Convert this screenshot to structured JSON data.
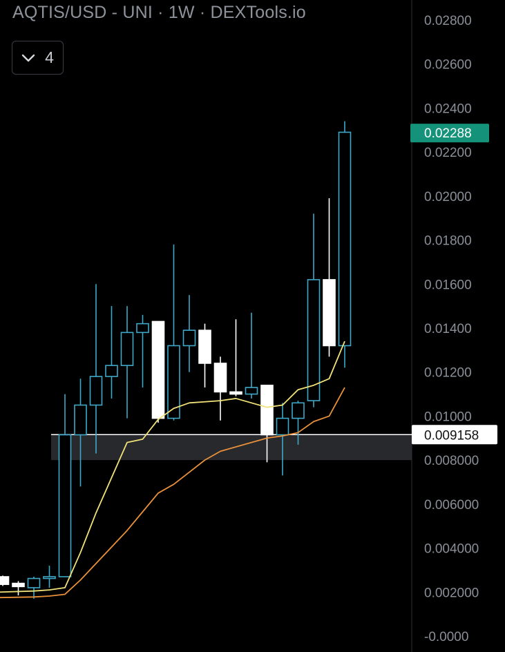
{
  "header": {
    "title": "AQTIS/USD - UNI · 1W · DEXTools.io",
    "indicator_count": "4",
    "collapse_icon": "chevron-down-icon"
  },
  "colors": {
    "background": "#000000",
    "up_candle": "#3fa9c9",
    "down_candle": "#ffffff",
    "ma_fast": "#f2e27a",
    "ma_slow": "#e8913a",
    "last_price_badge": "#14937a",
    "level_line": "#ffffff",
    "zone_fill": "#2b2d31",
    "axis_text": "#8a8f98"
  },
  "chart_data": {
    "type": "candlestick",
    "title": "AQTIS/USD - UNI · 1W · DEXTools.io",
    "y_axis_ticks": [
      "0.02800",
      "0.02600",
      "0.02400",
      "0.02200",
      "0.02000",
      "0.01800",
      "0.01600",
      "0.01400",
      "0.01200",
      "0.01000",
      "0.008000",
      "0.006000",
      "0.004000",
      "0.002000",
      "-0.0000"
    ],
    "ylim": [
      -0.0,
      0.029
    ],
    "grid": false,
    "last_price": "0.02288",
    "level_label": "0.009158",
    "level_value": 0.009158,
    "zone": [
      0.008,
      0.009158
    ],
    "candles": [
      {
        "o": 0.0027,
        "h": 0.00275,
        "l": 0.00228,
        "c": 0.00235
      },
      {
        "o": 0.0024,
        "h": 0.0025,
        "l": 0.00185,
        "c": 0.00225
      },
      {
        "o": 0.0022,
        "h": 0.0027,
        "l": 0.0017,
        "c": 0.00262
      },
      {
        "o": 0.00262,
        "h": 0.0032,
        "l": 0.0022,
        "c": 0.0027
      },
      {
        "o": 0.0027,
        "h": 0.011,
        "l": 0.0027,
        "c": 0.00915
      },
      {
        "o": 0.00915,
        "h": 0.0117,
        "l": 0.0068,
        "c": 0.0105
      },
      {
        "o": 0.0105,
        "h": 0.016,
        "l": 0.0083,
        "c": 0.0118
      },
      {
        "o": 0.0118,
        "h": 0.015,
        "l": 0.0108,
        "c": 0.0123
      },
      {
        "o": 0.0123,
        "h": 0.015,
        "l": 0.0099,
        "c": 0.0138
      },
      {
        "o": 0.0138,
        "h": 0.0146,
        "l": 0.0113,
        "c": 0.0142
      },
      {
        "o": 0.0143,
        "h": 0.0143,
        "l": 0.0097,
        "c": 0.0099
      },
      {
        "o": 0.0099,
        "h": 0.0178,
        "l": 0.0098,
        "c": 0.0132
      },
      {
        "o": 0.0132,
        "h": 0.0155,
        "l": 0.012,
        "c": 0.0139
      },
      {
        "o": 0.0139,
        "h": 0.0142,
        "l": 0.0113,
        "c": 0.0124
      },
      {
        "o": 0.0124,
        "h": 0.0127,
        "l": 0.0098,
        "c": 0.0111
      },
      {
        "o": 0.0111,
        "h": 0.0144,
        "l": 0.0109,
        "c": 0.011
      },
      {
        "o": 0.011,
        "h": 0.0147,
        "l": 0.0108,
        "c": 0.0113
      },
      {
        "o": 0.0114,
        "h": 0.0114,
        "l": 0.0079,
        "c": 0.00915
      },
      {
        "o": 0.00915,
        "h": 0.0106,
        "l": 0.0073,
        "c": 0.0099
      },
      {
        "o": 0.0099,
        "h": 0.0107,
        "l": 0.0087,
        "c": 0.0106
      },
      {
        "o": 0.0107,
        "h": 0.0192,
        "l": 0.0104,
        "c": 0.0162
      },
      {
        "o": 0.0162,
        "h": 0.0199,
        "l": 0.0127,
        "c": 0.0132
      },
      {
        "o": 0.0132,
        "h": 0.0234,
        "l": 0.0122,
        "c": 0.0229
      }
    ],
    "series": [
      {
        "type": "line",
        "values": [
          0.002,
          0.00205,
          0.0021,
          0.0022,
          0.0038,
          0.0056,
          0.0072,
          0.0088,
          0.00895,
          0.00985,
          0.01035,
          0.0106,
          0.01065,
          0.0107,
          0.0108,
          0.0106,
          0.0104,
          0.0105,
          0.0112,
          0.0114,
          0.0117,
          0.0134
        ]
      },
      {
        "type": "line",
        "values": [
          0.00175,
          0.00178,
          0.00182,
          0.0019,
          0.00255,
          0.0033,
          0.00405,
          0.0048,
          0.00565,
          0.0065,
          0.0069,
          0.00745,
          0.008,
          0.0084,
          0.0086,
          0.0088,
          0.009,
          0.0091,
          0.00925,
          0.00975,
          0.01,
          0.0113
        ]
      }
    ]
  }
}
